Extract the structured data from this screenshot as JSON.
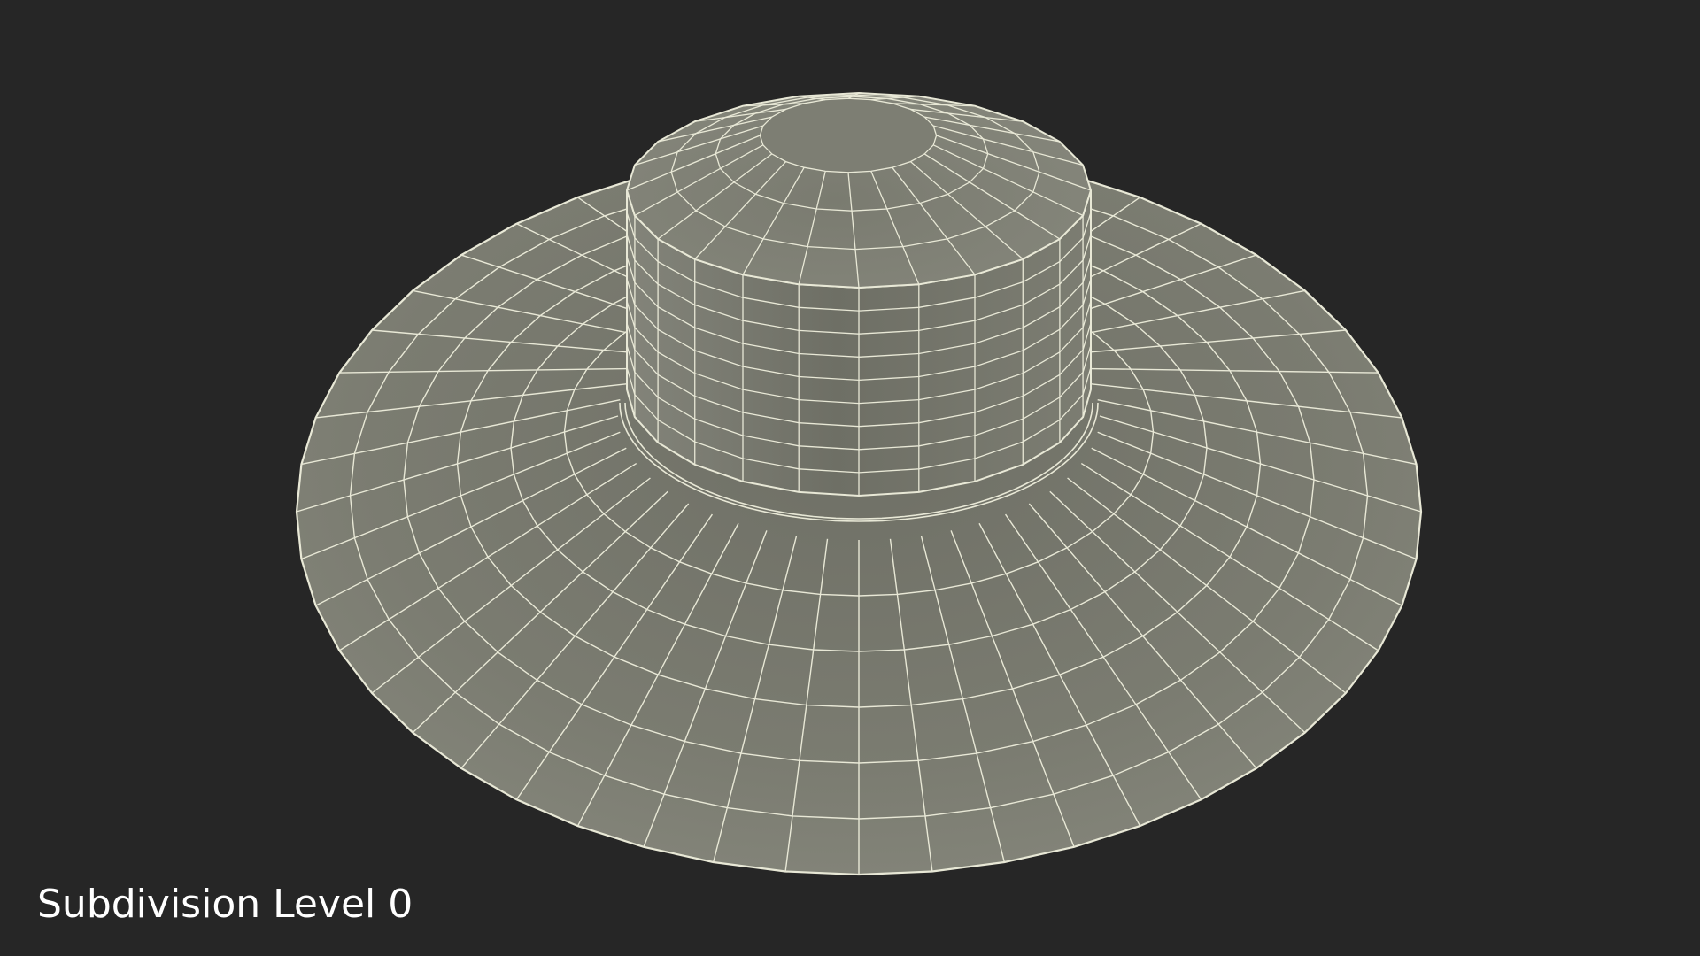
{
  "caption": "Subdivision Level 0",
  "colors": {
    "background": "#262626",
    "surface": "#797a6e",
    "wire": "#e8e8d6",
    "caption": "#ffffff"
  },
  "model": {
    "subject": "wide-brim-hat-wireframe",
    "brim_radial_segments": 48,
    "brim_rings": 6,
    "crown_radial_segments": 24,
    "crown_side_rows": 9,
    "top_rings": 3
  }
}
